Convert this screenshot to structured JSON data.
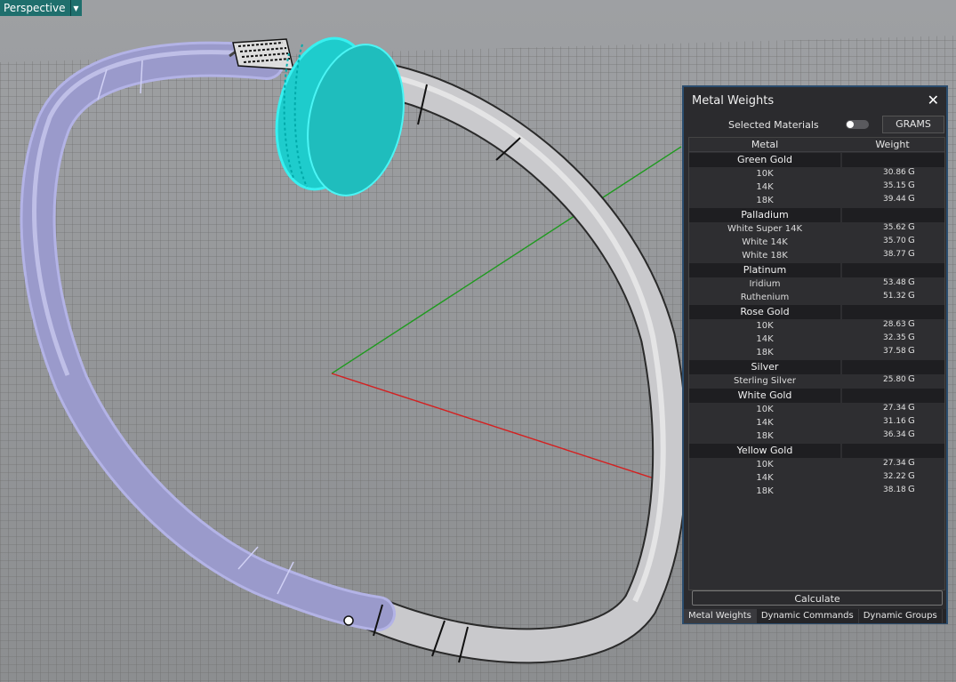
{
  "viewport": {
    "label": "Perspective"
  },
  "panel": {
    "title": "Metal Weights",
    "selected_materials_label": "Selected Materials",
    "units_button": "GRAMS",
    "columns": [
      "Metal",
      "Weight"
    ],
    "unit": "G",
    "groups": [
      {
        "name": "Green Gold",
        "items": [
          {
            "name": "10K",
            "weight": "30.86"
          },
          {
            "name": "14K",
            "weight": "35.15"
          },
          {
            "name": "18K",
            "weight": "39.44"
          }
        ]
      },
      {
        "name": "Palladium",
        "items": [
          {
            "name": "White Super 14K",
            "weight": "35.62"
          },
          {
            "name": "White 14K",
            "weight": "35.70"
          },
          {
            "name": "White 18K",
            "weight": "38.77"
          }
        ]
      },
      {
        "name": "Platinum",
        "items": [
          {
            "name": "Iridium",
            "weight": "53.48"
          },
          {
            "name": "Ruthenium",
            "weight": "51.32"
          }
        ]
      },
      {
        "name": "Rose Gold",
        "items": [
          {
            "name": "10K",
            "weight": "28.63"
          },
          {
            "name": "14K",
            "weight": "32.35"
          },
          {
            "name": "18K",
            "weight": "37.58"
          }
        ]
      },
      {
        "name": "Silver",
        "items": [
          {
            "name": "Sterling Silver",
            "weight": "25.80"
          }
        ]
      },
      {
        "name": "White Gold",
        "items": [
          {
            "name": "10K",
            "weight": "27.34"
          },
          {
            "name": "14K",
            "weight": "31.16"
          },
          {
            "name": "18K",
            "weight": "36.34"
          }
        ]
      },
      {
        "name": "Yellow Gold",
        "items": [
          {
            "name": "10K",
            "weight": "27.34"
          },
          {
            "name": "14K",
            "weight": "32.22"
          },
          {
            "name": "18K",
            "weight": "38.18"
          }
        ]
      }
    ],
    "calculate_button": "Calculate",
    "tabs": [
      {
        "label": "Metal Weights",
        "active": true
      },
      {
        "label": "Dynamic Commands",
        "active": false
      },
      {
        "label": "Dynamic Groups",
        "active": false
      }
    ]
  },
  "colors": {
    "accent": "#1f6f6d",
    "panel_border": "#2b4d6e",
    "selection": "#22d3d3",
    "band_selected": "#9a9acb",
    "band": "#c7c7c9"
  }
}
